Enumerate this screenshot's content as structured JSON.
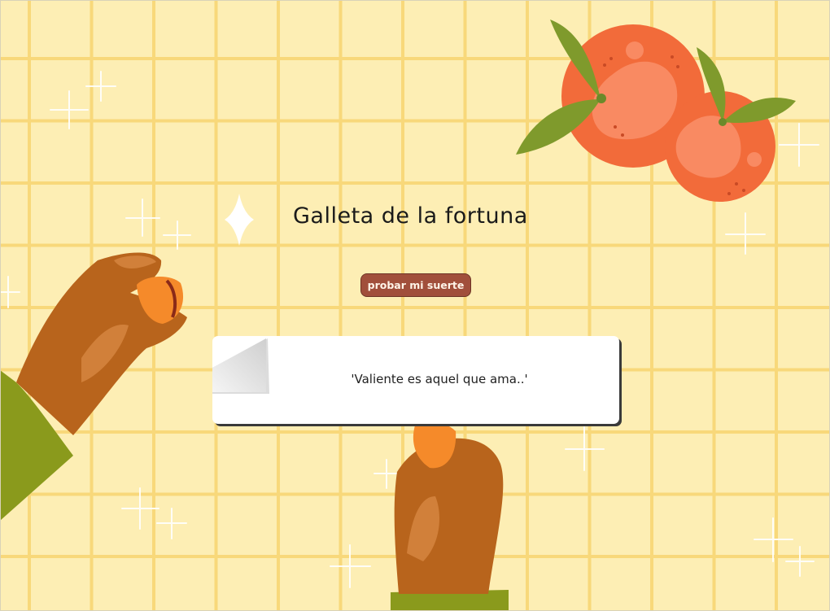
{
  "header": {
    "title": "Galleta de la fortuna"
  },
  "actions": {
    "try_luck_label": "probar mi suerte"
  },
  "fortune": {
    "message": "'Valiente es aquel que ama..'"
  },
  "colors": {
    "background": "#fdeeb4",
    "grid_lines": "#f8d87a",
    "button": "#a14f3b",
    "orange": "#f26b3a",
    "leaf": "#7f9a2c",
    "skin": "#b8641c",
    "sleeve": "#8a9a1c"
  },
  "decorations": [
    "oranges-illustration",
    "hand-holding-cookie-left",
    "hand-holding-cookie-bottom",
    "sparkle-icons"
  ]
}
